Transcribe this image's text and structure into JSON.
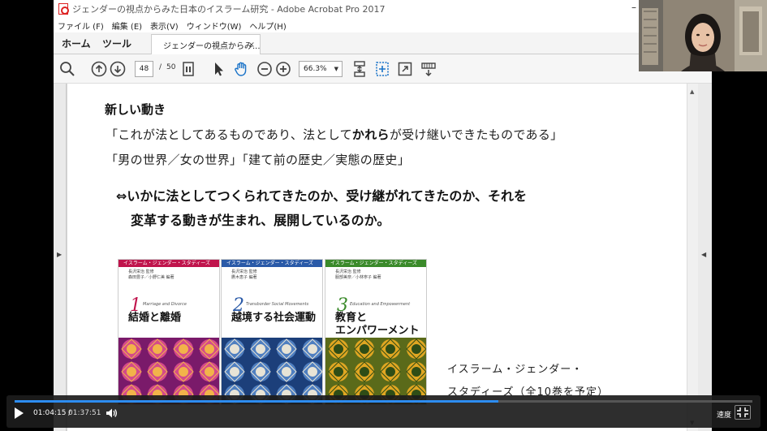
{
  "window": {
    "title": "ジェンダーの視点からみた日本のイスラーム研究 - Adobe Acrobat Pro 2017",
    "minimize": "–"
  },
  "menu": [
    "ファイル (F)",
    "編集 (E)",
    "表示(V)",
    "ウィンドウ(W)",
    "ヘルプ(H)"
  ],
  "nav": {
    "home": "ホーム",
    "tools": "ツール"
  },
  "doc_tab": {
    "label": "ジェンダーの視点からみ...",
    "close": "×"
  },
  "toolbar": {
    "page_current": "48",
    "page_sep": "/",
    "page_total": "50",
    "zoom": "66.3%",
    "zoom_arrow": "▼"
  },
  "content": {
    "heading": "新しい動き",
    "quote1_a": "「これが法としてあるものであり、法として",
    "quote1_b": "かれら",
    "quote1_c": "が受け継いできたものである」",
    "quote2": "「男の世界／女の世界」「建て前の歴史／実態の歴史」",
    "question_l1": "⇔いかに法としてつくられてきたのか、受け継がれてきたのか、それを",
    "question_l2": "変革する動きが生まれ、展開しているのか。",
    "series_caption_l1": "イスラーム・ジェンダー・",
    "series_caption_l2": "スタディーズ（全10巻を予定）"
  },
  "books": [
    {
      "series": "イスラーム・ジェンダー・スタディーズ",
      "editors_1": "長沢栄治 監修",
      "editors_2": "森田豊子／小野仁美 編著",
      "num": "1",
      "eng": "Marriage and Divorce",
      "title_1": "結婚と離婚",
      "title_2": "",
      "accent": "#c0144c",
      "color": "#c0144c"
    },
    {
      "series": "イスラーム・ジェンダー・スタディーズ",
      "editors_1": "長沢栄治 監修",
      "editors_2": "鷹木恵子 編著",
      "num": "2",
      "eng": "Transborder Social Movements",
      "title_1": "越境する社会運動",
      "title_2": "",
      "accent": "#2a5aa8",
      "color": "#2a5aa8"
    },
    {
      "series": "イスラーム・ジェンダー・スタディーズ",
      "editors_1": "長沢栄治 監修",
      "editors_2": "服部美奈／小林寧子 編著",
      "num": "3",
      "eng": "Education and Empowerment",
      "title_1": "教育と",
      "title_2": "エンパワーメント",
      "accent": "#3a8a2a",
      "color": "#3a8a2a"
    }
  ],
  "player": {
    "time_current": "01:04:15",
    "time_sep": "/",
    "time_total": "01:37:51",
    "speed_label": "速度",
    "progress": 0.656
  },
  "colors": {
    "progress": "#2d8cf0",
    "hand_tool": "#1a73c8"
  }
}
